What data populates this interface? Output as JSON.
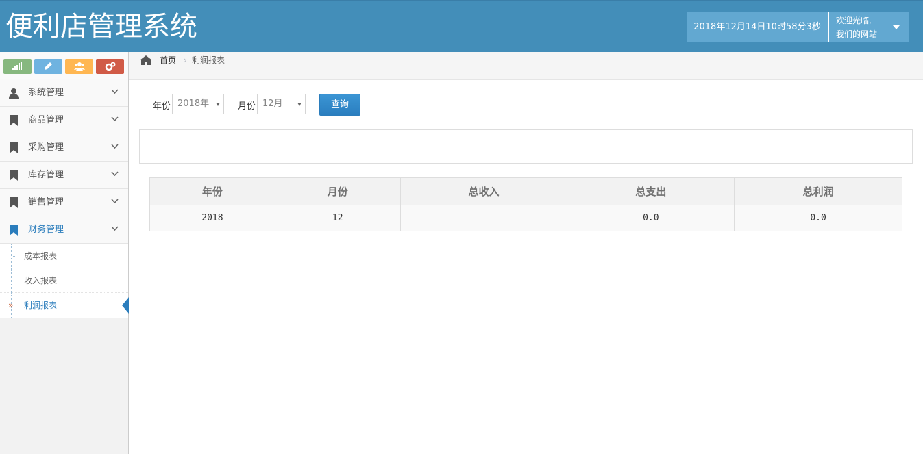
{
  "header": {
    "brand": "便利店管理系统",
    "datetime": "2018年12月14日10时58分3秒",
    "welcome_line1": "欢迎光临,",
    "welcome_line2": "我们的网站"
  },
  "shortcuts": [
    {
      "name": "signal-icon",
      "color": "#87b87f"
    },
    {
      "name": "pencil-icon",
      "color": "#6fb3e0"
    },
    {
      "name": "group-icon",
      "color": "#ffb752"
    },
    {
      "name": "cogs-icon",
      "color": "#d15b47"
    }
  ],
  "sidebar": {
    "items": [
      {
        "label": "系统管理",
        "icon": "user-icon"
      },
      {
        "label": "商品管理",
        "icon": "bookmark-icon"
      },
      {
        "label": "采购管理",
        "icon": "bookmark-icon"
      },
      {
        "label": "库存管理",
        "icon": "bookmark-icon"
      },
      {
        "label": "销售管理",
        "icon": "bookmark-icon"
      },
      {
        "label": "财务管理",
        "icon": "bookmark-icon"
      }
    ],
    "sub_items": [
      {
        "label": "成本报表"
      },
      {
        "label": "收入报表"
      },
      {
        "label": "利润报表"
      }
    ],
    "active_bullet": "»"
  },
  "breadcrumb": {
    "home": "首页",
    "separator": "›",
    "current": "利润报表"
  },
  "filter": {
    "year_label": "年份",
    "year_value": "2018年",
    "month_label": "月份",
    "month_value": "12月",
    "query_button": "查询"
  },
  "table": {
    "headers": [
      "年份",
      "月份",
      "总收入",
      "总支出",
      "总利润"
    ],
    "rows": [
      [
        "2018",
        "12",
        "",
        "0.0",
        "0.0"
      ]
    ]
  }
}
